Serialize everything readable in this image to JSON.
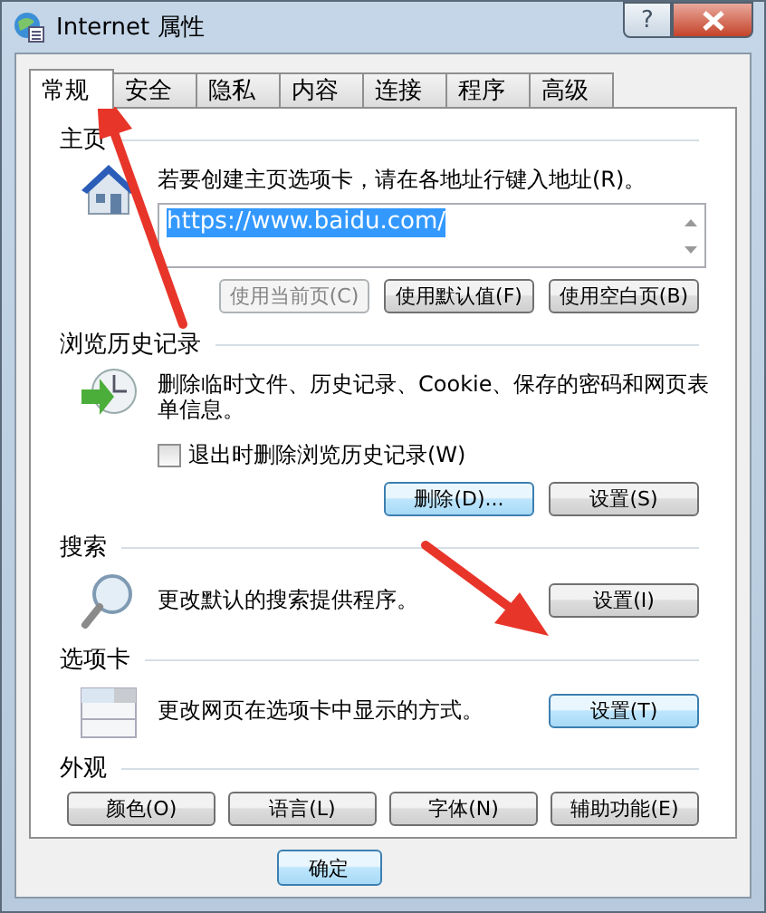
{
  "window": {
    "title": "Internet 属性",
    "help": "?"
  },
  "tabs": [
    {
      "label": "常规",
      "selected": true
    },
    {
      "label": "安全",
      "selected": false
    },
    {
      "label": "隐私",
      "selected": false
    },
    {
      "label": "内容",
      "selected": false
    },
    {
      "label": "连接",
      "selected": false
    },
    {
      "label": "程序",
      "selected": false
    },
    {
      "label": "高级",
      "selected": false
    }
  ],
  "home_page": {
    "heading": "主页",
    "description": "若要创建主页选项卡，请在各地址行键入地址(R)。",
    "url": "https://www.baidu.com/",
    "url_selected": true,
    "buttons": [
      {
        "label": "使用当前页(C)",
        "disabled": true,
        "highlighted": false
      },
      {
        "label": "使用默认值(F)",
        "disabled": false,
        "highlighted": false
      },
      {
        "label": "使用空白页(B)",
        "disabled": false,
        "highlighted": false
      }
    ]
  },
  "history": {
    "heading": "浏览历史记录",
    "description": "删除临时文件、历史记录、Cookie、保存的密码和网页表单信息。",
    "checkbox": {
      "label": "退出时删除浏览历史记录(W)",
      "checked": false
    },
    "buttons": [
      {
        "label": "删除(D)...",
        "disabled": false,
        "highlighted": true
      },
      {
        "label": "设置(S)",
        "disabled": false,
        "highlighted": false
      }
    ]
  },
  "search": {
    "heading": "搜索",
    "description": "更改默认的搜索提供程序。",
    "button": {
      "label": "设置(I)",
      "disabled": false,
      "highlighted": false
    }
  },
  "tabs_section": {
    "heading": "选项卡",
    "description": "更改网页在选项卡中显示的方式。",
    "button": {
      "label": "设置(T)",
      "disabled": false,
      "highlighted": true
    }
  },
  "appearance": {
    "heading": "外观",
    "buttons": [
      {
        "label": "颜色(O)",
        "disabled": false,
        "highlighted": false
      },
      {
        "label": "语言(L)",
        "disabled": false,
        "highlighted": false
      },
      {
        "label": "字体(N)",
        "disabled": false,
        "highlighted": false
      },
      {
        "label": "辅助功能(E)",
        "disabled": false,
        "highlighted": false
      }
    ]
  },
  "footer_buttons": [
    {
      "label": "确定",
      "disabled": false,
      "highlighted": true
    }
  ]
}
